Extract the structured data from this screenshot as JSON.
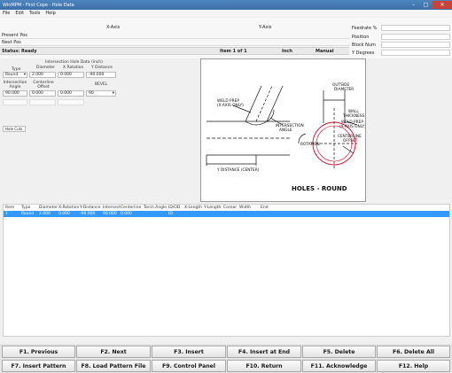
{
  "window": {
    "title": "WinMPM - First Cope - Hole Data"
  },
  "menu": [
    "File",
    "Edit",
    "Tools",
    "Help"
  ],
  "info": {
    "present_pos": "Present Pos",
    "next_pos": "Next Pos",
    "status": "Status: Ready",
    "x_axis": "X-Axis",
    "y_axis": "Y-Axis",
    "item_of": "Item 1 of 1",
    "units": "Inch",
    "mode": "Manual",
    "right_labels": [
      "Feedrate %",
      "Position",
      "Block Num",
      "Y Degrees"
    ]
  },
  "panel": {
    "group_title": "Intersection Hole Data (inch)",
    "type_label": "Type",
    "type_value": "Round",
    "diameter_label": "Diameter",
    "diameter_value": "2.000",
    "xrot_label": "X Rotation",
    "xrot_value": "0.000",
    "ydist_label": "Y Distance",
    "ydist_value": "-90.000",
    "int_angle_label": "Intersection Angle",
    "int_angle_value": "90.000",
    "cl_offset_label": "Centerline Offset",
    "cl_offset_value": "0.000",
    "col5_label": "",
    "col5_value": "0.000",
    "bevel_label": "BEVEL",
    "bevel_value": "90",
    "row3_faded": [
      "",
      "",
      ""
    ],
    "side_label": "Hole Cuts"
  },
  "diagram": {
    "labels": {
      "weld_prep_left": "WELD PREP\n(X-AXIS ONLY)",
      "intersection_angle": "INTERSECTION\nANGLE",
      "rotation": "ROTATION",
      "y_distance": "Y DISTANCE (CENTER)",
      "outside_diameter": "OUTSIDE\nDIAMETER",
      "wall_thickness": "WALL\nTHICKNESS",
      "weld_prep_right": "WELD PREP\n(X-AXIS ONLY)",
      "centerline_offset": "CENTERLINE\nOFFSET"
    },
    "caption": "HOLES - ROUND",
    "accent": "#e0001a"
  },
  "table": {
    "headers": [
      "Item",
      "Type",
      "Diameter",
      "X-Rotation",
      "Y-Distance",
      "Intersect",
      "Centerline",
      "Torch Angle",
      "ID/OD",
      "X-Length",
      "Y-Length",
      "Corner",
      "Width",
      "End"
    ],
    "rows": [
      [
        "1",
        "Round",
        "2.000",
        "0.000",
        "-90.000",
        "90.000",
        "0.000",
        "",
        "ID",
        "",
        "",
        "",
        "",
        ""
      ]
    ]
  },
  "fkeys": [
    "F1. Previous",
    "F2. Next",
    "F3. Insert",
    "F4. Insert at End",
    "F5. Delete",
    "F6. Delete All",
    "F7. Insert Pattern",
    "F8. Load Pattern File",
    "F9. Control Panel",
    "F10. Return",
    "F11. Acknowledge",
    "F12. Help"
  ]
}
